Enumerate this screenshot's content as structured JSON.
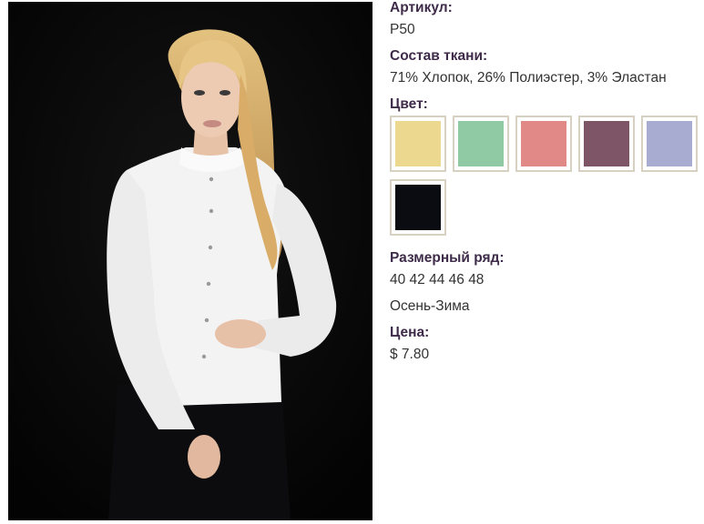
{
  "product_image": {
    "description_icon": "product-photo"
  },
  "article": {
    "label": "Артикул:",
    "value": "P50"
  },
  "fabric": {
    "label": "Состав ткани:",
    "value": "71% Хлопок, 26% Полиэстер, 3% Эластан"
  },
  "color": {
    "label": "Цвет:",
    "swatches": [
      {
        "name": "yellow",
        "hex": "#ecd98f"
      },
      {
        "name": "mint",
        "hex": "#8fcaa4"
      },
      {
        "name": "pink",
        "hex": "#e08987"
      },
      {
        "name": "plum",
        "hex": "#7e5566"
      },
      {
        "name": "lavender",
        "hex": "#a7acd0"
      },
      {
        "name": "black",
        "hex": "#0b0b12"
      }
    ]
  },
  "sizes": {
    "label": "Размерный ряд:",
    "value": "40 42 44 46 48"
  },
  "season": {
    "value": "Осень-Зима"
  },
  "price": {
    "label": "Цена:",
    "value": "$ 7.80"
  }
}
